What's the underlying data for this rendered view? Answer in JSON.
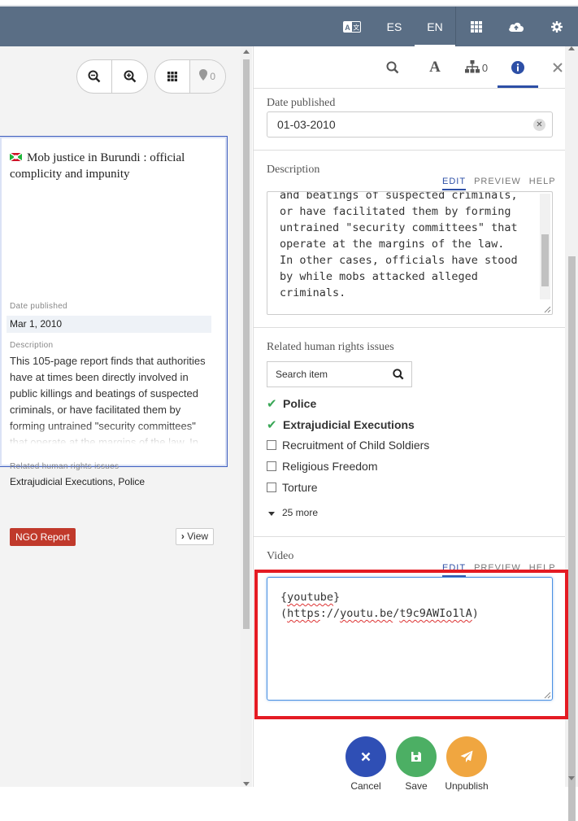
{
  "topbar": {
    "translate_icon": "translate-icon",
    "lang_es": "ES",
    "lang_en": "EN",
    "apps_icon": "grid-icon",
    "upload_icon": "cloud-upload-icon",
    "settings_icon": "gear-icon"
  },
  "left_toolbar": {
    "zoom_out_icon": "zoom-out-icon",
    "zoom_in_icon": "zoom-in-icon",
    "grid_icon": "grid-icon",
    "map_icon": "map-pin-icon",
    "map_count": "0"
  },
  "card": {
    "title": "Mob justice in Burundi : official complicity and impunity",
    "date_label": "Date published",
    "date_value": "Mar 1, 2010",
    "desc_label": "Description",
    "desc_text": "This 105-page report finds that authorities have at times been directly involved in public killings and beatings of suspected criminals, or have facilitated them by forming untrained \"security committees\" that operate at the margins of the law. In",
    "issues_label": "Related human rights issues",
    "issues_value": "Extrajudicial Executions, Police",
    "badge": "NGO Report",
    "view_label": "View"
  },
  "right_tabs": {
    "search_icon": "search-icon",
    "font_icon": "font-icon",
    "relations_icon": "hierarchy-icon",
    "relations_count": "0",
    "info_icon": "info-icon",
    "close_icon": "close-icon"
  },
  "form": {
    "date_label": "Date published",
    "date_value": "01-03-2010",
    "description_label": "Description",
    "md_tabs": {
      "edit": "EDIT",
      "preview": "PREVIEW",
      "help": "HELP"
    },
    "description_lines": [
      "and beatings of suspected criminals,",
      "or have facilitated them by forming",
      "untrained \"security committees\" that",
      "operate at the margins of the law.",
      "In other cases, officials have stood",
      "by while mobs attacked alleged",
      "criminals."
    ],
    "issues_label": "Related human rights issues",
    "search_placeholder": "Search item",
    "issues": [
      {
        "label": "Police",
        "checked": true
      },
      {
        "label": "Extrajudicial Executions",
        "checked": true
      },
      {
        "label": "Recruitment of Child Soldiers",
        "checked": false
      },
      {
        "label": "Religious Freedom",
        "checked": false
      },
      {
        "label": "Torture",
        "checked": false
      }
    ],
    "more": "25 more",
    "video_label": "Video",
    "video_line1": "{youtube}",
    "video_url_parts": {
      "open": "(",
      "https": "https",
      "sep1": "://",
      "host": "youtu.be",
      "sep2": "/",
      "id": "t9c9AWIo1lA",
      "close": ")"
    }
  },
  "actions": {
    "cancel": "Cancel",
    "save": "Save",
    "unpublish": "Unpublish",
    "colors": {
      "cancel": "#2f4fb5",
      "save": "#4caf64",
      "unpublish": "#f0a640"
    }
  }
}
